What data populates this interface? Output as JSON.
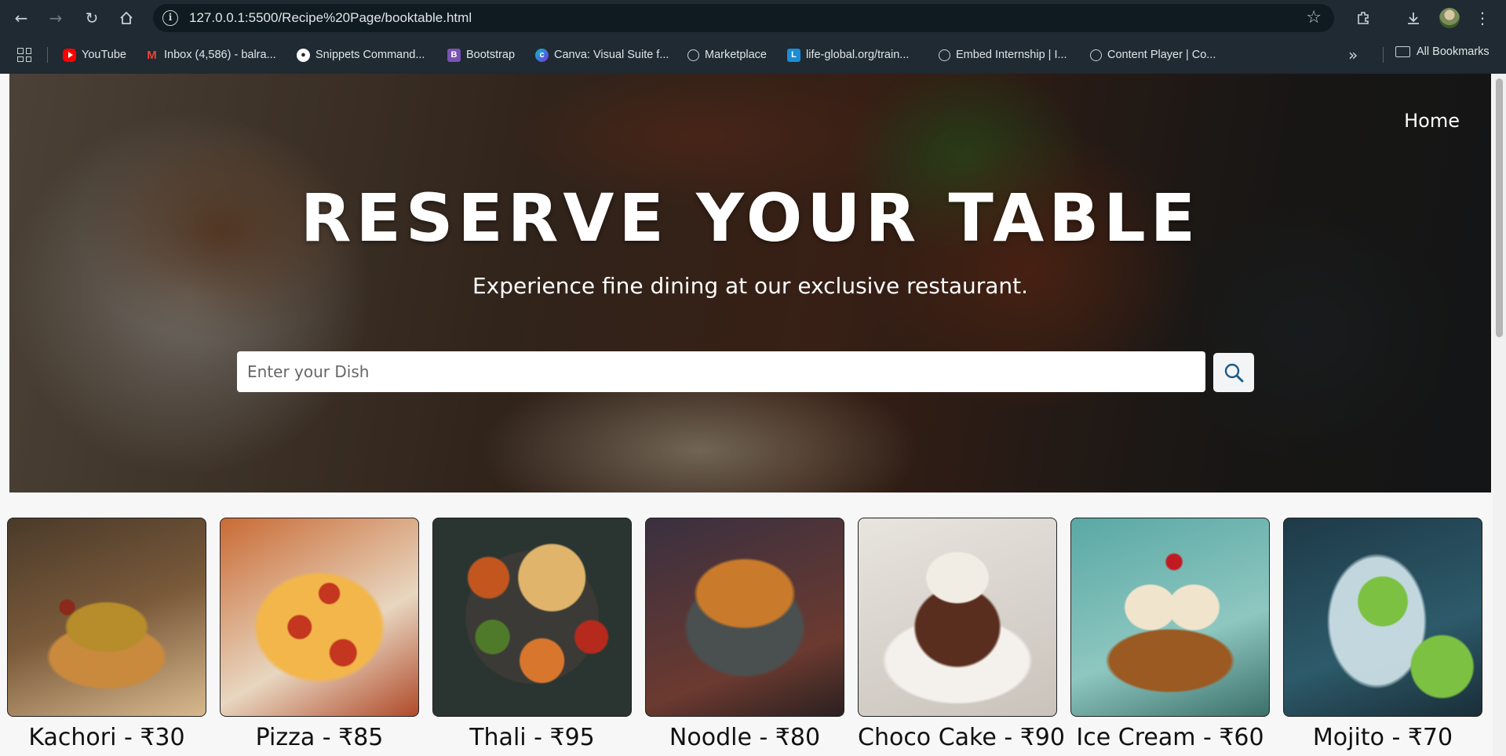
{
  "browser": {
    "url": "127.0.0.1:5500/Recipe%20Page/booktable.html",
    "bookmarks": [
      {
        "label": "YouTube",
        "icon": "youtube-icon"
      },
      {
        "label": "Inbox (4,586) - balra...",
        "icon": "gmail-icon"
      },
      {
        "label": "Snippets Command...",
        "icon": "github-icon"
      },
      {
        "label": "Bootstrap",
        "icon": "bootstrap-icon"
      },
      {
        "label": "Canva: Visual Suite f...",
        "icon": "canva-icon"
      },
      {
        "label": "Marketplace",
        "icon": "globe-icon"
      },
      {
        "label": "life-global.org/train...",
        "icon": "life-global-icon"
      },
      {
        "label": "Embed Internship | I...",
        "icon": "globe-icon"
      },
      {
        "label": "Content Player | Co...",
        "icon": "globe-icon"
      }
    ],
    "all_bookmarks_label": "All Bookmarks"
  },
  "page": {
    "nav": {
      "home_label": "Home"
    },
    "hero": {
      "title": "RESERVE YOUR TABLE",
      "subtitle": "Experience fine dining at our exclusive restaurant."
    },
    "search": {
      "placeholder": "Enter your Dish",
      "value": ""
    },
    "dishes": [
      {
        "label": "Kachori - ₹30"
      },
      {
        "label": "Pizza - ₹85"
      },
      {
        "label": "Thali - ₹95"
      },
      {
        "label": "Noodle - ₹80"
      },
      {
        "label": "Choco Cake - ₹90"
      },
      {
        "label": "Ice Cream - ₹60"
      },
      {
        "label": "Mojito - ₹70"
      }
    ]
  }
}
